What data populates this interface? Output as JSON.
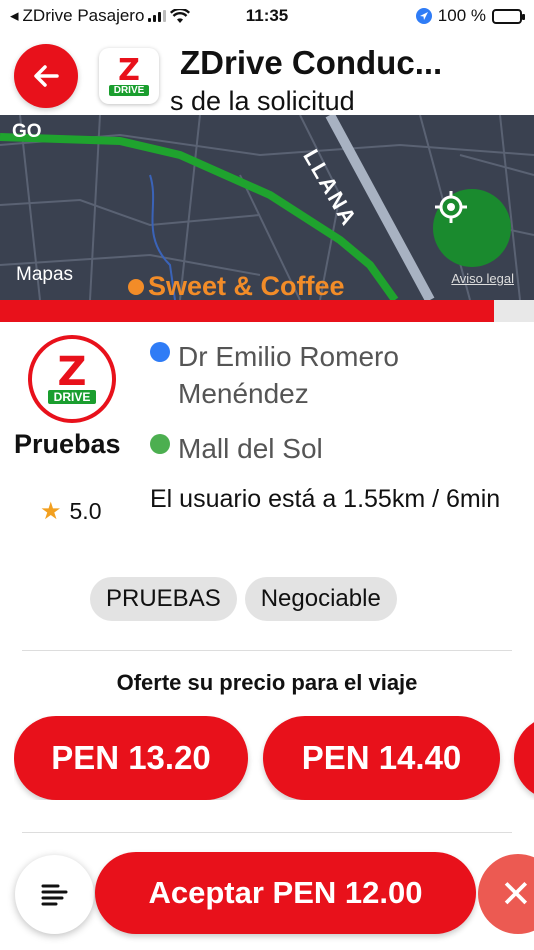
{
  "status_bar": {
    "back_app": "ZDrive Pasajero",
    "time": "11:35",
    "battery": "100 %"
  },
  "header": {
    "title": "ZDrive Conduc...",
    "subtitle": "s de la solicitud",
    "logo_letter": "Z",
    "logo_text": "DRIVE"
  },
  "map": {
    "attribution": "Mapas",
    "street_label": "LLANA",
    "street_label_left": "GO",
    "poi": "Sweet & Coffee",
    "legal": "Aviso legal",
    "route_color": "#1fa32e"
  },
  "progress": {
    "fraction": 0.925
  },
  "request": {
    "avatar_letter": "Z",
    "avatar_text": "DRIVE",
    "user_name": "Pruebas",
    "rating": "5.0",
    "origin": "Dr Emilio Romero Menéndez",
    "destination": "Mall del Sol",
    "distance": "El usuario está a 1.55km / 6min",
    "tags": [
      "PRUEBAS",
      "Negociable"
    ]
  },
  "offer": {
    "title": "Oferte su precio para el viaje",
    "prices": [
      "PEN 13.20",
      "PEN 14.40"
    ]
  },
  "actions": {
    "accept": "Aceptar PEN 12.00",
    "close": "✕"
  },
  "colors": {
    "primary": "#e8111b",
    "green": "#1a8a2e",
    "origin_dot": "#2f7cf6",
    "dest_dot": "#4caf50"
  }
}
